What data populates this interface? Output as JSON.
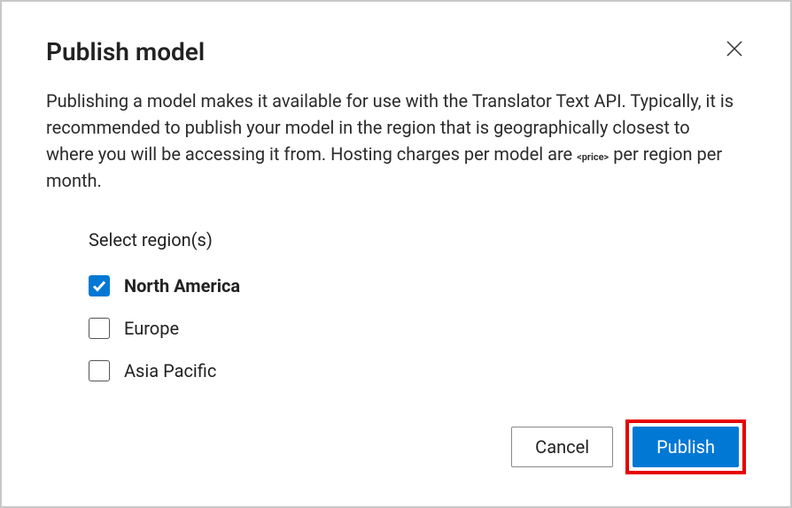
{
  "dialog": {
    "title": "Publish model",
    "description_part1": "Publishing a model makes it available for use with the Translator Text API. Typically, it is recommended to publish your model in the region that is geographically closest to where you will be accessing it from. Hosting charges per model are",
    "price_placeholder": "<price>",
    "description_part2": "per region per month.",
    "region_section_label": "Select region(s)",
    "regions": [
      {
        "label": "North America",
        "checked": true
      },
      {
        "label": "Europe",
        "checked": false
      },
      {
        "label": "Asia Pacific",
        "checked": false
      }
    ],
    "buttons": {
      "cancel": "Cancel",
      "publish": "Publish"
    }
  }
}
